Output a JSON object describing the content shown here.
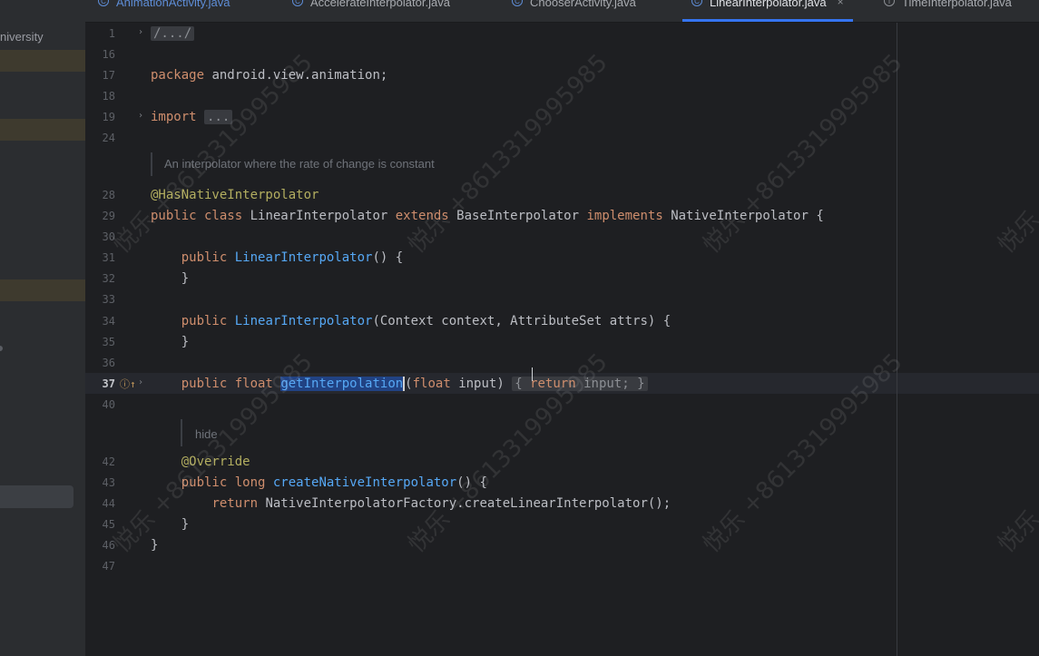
{
  "left_panel": {
    "label": "niversity"
  },
  "tabs": [
    {
      "label": "AnimationActivity.java",
      "icon": "class-icon"
    },
    {
      "label": "AccelerateInterpolator.java",
      "icon": "class-icon"
    },
    {
      "label": "ChooserActivity.java",
      "icon": "class-icon"
    },
    {
      "label": "LinearInterpolator.java",
      "icon": "class-icon",
      "active": true,
      "close": "×"
    },
    {
      "label": "TimeInterpolator.java",
      "icon": "interface-icon"
    }
  ],
  "line_numbers": [
    "1",
    "16",
    "17",
    "18",
    "19",
    "24",
    "28",
    "29",
    "30",
    "31",
    "32",
    "33",
    "34",
    "35",
    "36",
    "37",
    "40",
    "42",
    "43",
    "44",
    "45",
    "46",
    "47"
  ],
  "code": {
    "l1": "/.../",
    "l17_kw": "package",
    "l17_rest": " android.view.animation;",
    "l19_kw": "import",
    "l19_fold": "...",
    "doc1": "An interpolator where the rate of change is constant",
    "l28": "@HasNativeInterpolator",
    "l29_a": "public class",
    "l29_b": " LinearInterpolator ",
    "l29_c": "extends",
    "l29_d": " BaseInterpolator ",
    "l29_e": "implements",
    "l29_f": " NativeInterpolator {",
    "l31_kw": "public",
    "l31_fn": "LinearInterpolator",
    "l31_rest": "() {",
    "l32": "}",
    "l34_kw": "public",
    "l34_fn": "LinearInterpolator",
    "l34_rest": "(Context context, AttributeSet attrs) {",
    "l35": "}",
    "l37_kw1": "public float",
    "l37_fn": "getInterpolation",
    "l37_p1": "(",
    "l37_kw2": "float",
    "l37_p2": " input) ",
    "l37_b1": "{",
    "l37_kw3": "return",
    "l37_p3": " input; ",
    "l37_b2": "}",
    "doc2": "hide",
    "l42": "@Override",
    "l43_kw": "public long",
    "l43_fn": "createNativeInterpolator",
    "l43_rest": "() {",
    "l44_kw": "return",
    "l44_rest": " NativeInterpolatorFactory.createLinearInterpolator();",
    "l45": "}",
    "l46": "}"
  },
  "watermark": "悦乐 +8613319995985"
}
